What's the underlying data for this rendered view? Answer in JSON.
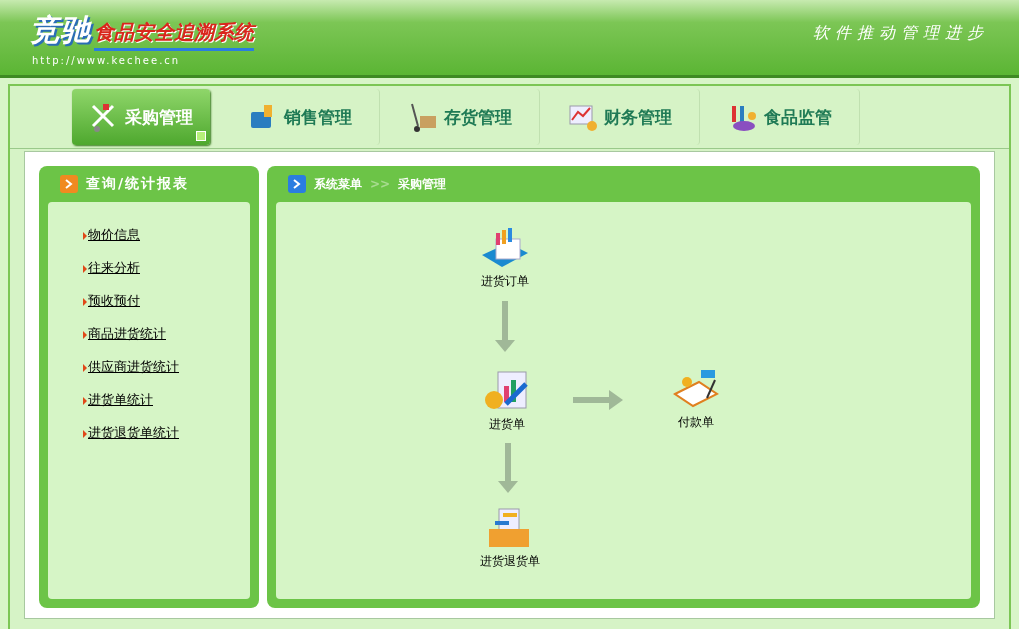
{
  "header": {
    "brand": "竞驰",
    "system_name": "食品安全追溯系统",
    "url": "http://www.kechee.cn",
    "slogan": "软件推动管理进步"
  },
  "nav_tabs": [
    {
      "label": "采购管理",
      "kind": "purchase",
      "selected": true
    },
    {
      "label": "销售管理",
      "kind": "sales",
      "selected": false
    },
    {
      "label": "存货管理",
      "kind": "stock",
      "selected": false
    },
    {
      "label": "财务管理",
      "kind": "finance",
      "selected": false
    },
    {
      "label": "食品监管",
      "kind": "supervise",
      "selected": false
    }
  ],
  "sidebar": {
    "title": "查询/统计报表",
    "items": [
      "物价信息",
      "往来分析",
      "预收预付",
      "商品进货统计",
      "供应商进货统计",
      "进货单统计",
      "进货退货单统计"
    ]
  },
  "breadcrumb": [
    "系统菜单",
    ">>",
    "采购管理"
  ],
  "flow_nodes": [
    {
      "label": "进货订单",
      "kind": "order"
    },
    {
      "label": "进货单",
      "kind": "receipt"
    },
    {
      "label": "付款单",
      "kind": "payment"
    },
    {
      "label": "进货退货单",
      "kind": "return"
    }
  ]
}
